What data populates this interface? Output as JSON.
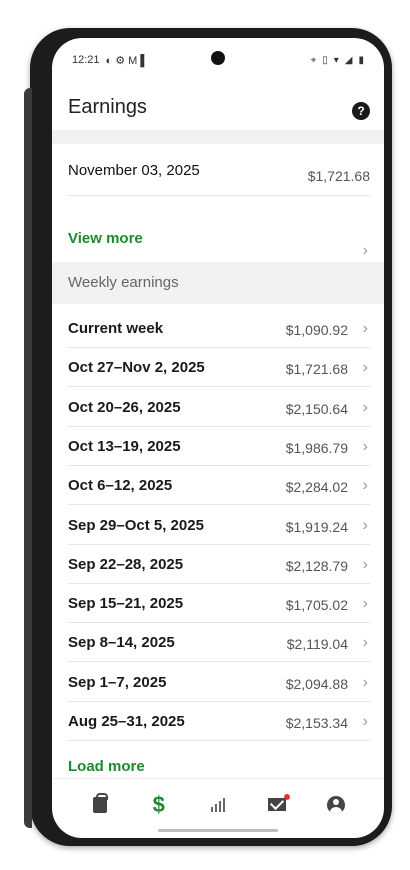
{
  "status": {
    "time": "12:21"
  },
  "appbar": {
    "title": "Earnings"
  },
  "summary": {
    "date": "November 03, 2025",
    "amount": "$1,721.68",
    "view_more": "View more"
  },
  "weekly": {
    "label": "Weekly earnings",
    "rows": [
      {
        "label": "Current week",
        "amount": "$1,090.92"
      },
      {
        "label": "Oct 27–Nov 2, 2025",
        "amount": "$1,721.68"
      },
      {
        "label": "Oct 20–26, 2025",
        "amount": "$2,150.64"
      },
      {
        "label": "Oct 13–19, 2025",
        "amount": "$1,986.79"
      },
      {
        "label": "Oct 6–12, 2025",
        "amount": "$2,284.02"
      },
      {
        "label": "Sep 29–Oct 5, 2025",
        "amount": "$1,919.24"
      },
      {
        "label": "Sep 22–28, 2025",
        "amount": "$2,128.79"
      },
      {
        "label": "Sep 15–21, 2025",
        "amount": "$1,705.02"
      },
      {
        "label": "Sep 8–14, 2025",
        "amount": "$2,119.04"
      },
      {
        "label": "Sep 1–7, 2025",
        "amount": "$2,094.88"
      },
      {
        "label": "Aug 25–31, 2025",
        "amount": "$2,153.34"
      }
    ],
    "load_more": "Load more"
  },
  "icons": {
    "help": "help-icon",
    "chevron": "chevron-right-icon",
    "nav": [
      "shopping-bag-icon",
      "dollar-icon",
      "bar-chart-icon",
      "mail-icon",
      "account-icon"
    ]
  },
  "colors": {
    "accent": "#1e8a2e",
    "notification": "#d33333"
  }
}
